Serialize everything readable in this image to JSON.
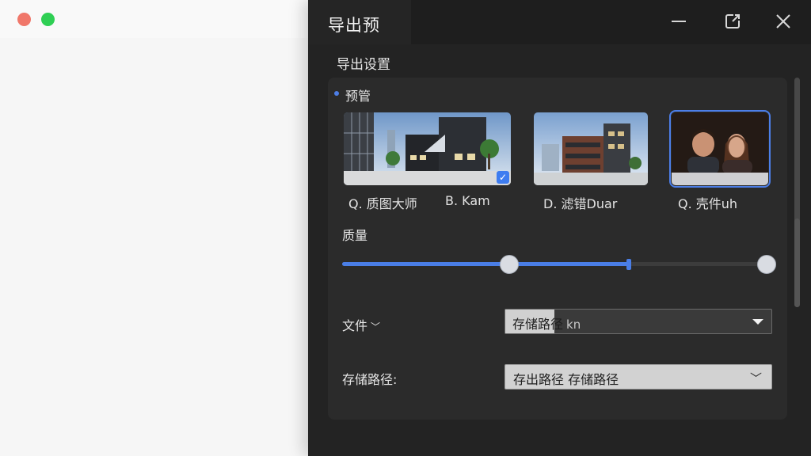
{
  "dialog": {
    "title": "导出预",
    "section_header": "导出设置",
    "sub_label": "预管",
    "thumbnails": [
      {
        "label": "Q. 质图大师",
        "checked": true
      },
      {
        "label": "B. Kam"
      },
      {
        "label": "D. 滤错Duar"
      },
      {
        "label": "Q. 壳件uh",
        "selected": true
      }
    ],
    "quality": {
      "label": "质量",
      "value_fraction": 0.38,
      "marker_fraction": 0.66
    },
    "file_row": {
      "label": "文件",
      "value": "存储路径",
      "ghost": "kn"
    },
    "path_row": {
      "label": "存储路径:",
      "value": "存出路径 存储路径"
    }
  },
  "colors": {
    "accent": "#4a7ee6",
    "dialog_bg": "#232323",
    "traffic_red": "#f0776a",
    "traffic_green": "#2fcf54"
  }
}
